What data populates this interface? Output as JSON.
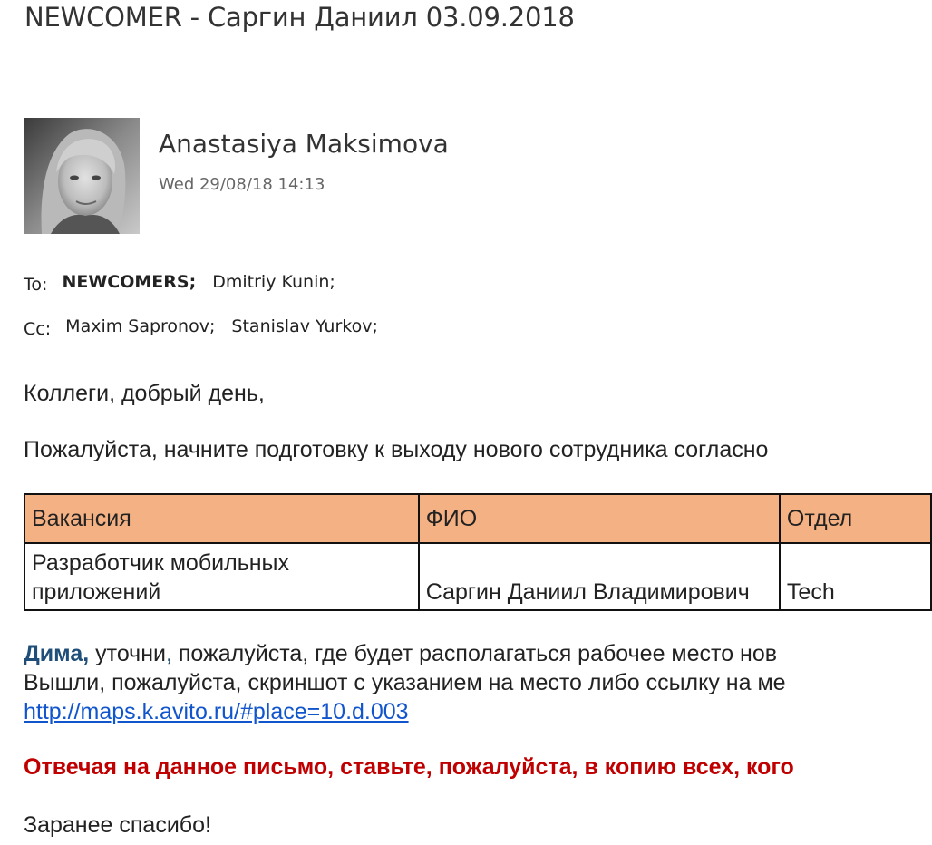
{
  "email": {
    "subject_prefix": "NEWCOMER - ",
    "subject_person": "Саргин Даниил",
    "subject_date": " 03.09.2018",
    "sender_name": "Anastasiya Maksimova",
    "sent_date": "Wed 29/08/18 14:13",
    "to_label": "To:",
    "to": [
      "NEWCOMERS;",
      "Dmitriy Kunin;"
    ],
    "cc_label": "Cc:",
    "cc": [
      "Maxim Sapronov;",
      "Stanislav Yurkov;"
    ]
  },
  "body": {
    "greeting": "Коллеги, добрый день,",
    "request": "Пожалуйста, начните подготовку к выходу нового сотрудника согласно",
    "table": {
      "headers": [
        "Вакансия",
        "ФИО",
        "Отдел"
      ],
      "row": {
        "vacancy_line1": "Разработчик мобильных",
        "vacancy_line2": "приложений",
        "name": "Саргин Даниил Владимирович",
        "dept": "Tech"
      },
      "header_color": "#f4b183"
    },
    "mention": "Дима",
    "mention_comma": ",",
    "dima_line1_a": " уточни",
    "dima_line1_comma": ",",
    "dima_line1_b": " пожалуйста, где будет располагаться рабочее место нов",
    "dima_line2": "Вышли, пожалуйста, скриншот с указанием на место либо ссылку на ме",
    "link": "http://maps.k.avito.ru/#place=10.d.003",
    "warning": "Отвечая на данное письмо, ставьте, пожалуйста, в копию всех, кого",
    "thanks": "Заранее спасибо!"
  },
  "colors": {
    "mention": "#1f4e79",
    "warning": "#c00000",
    "link": "#1155cc"
  }
}
